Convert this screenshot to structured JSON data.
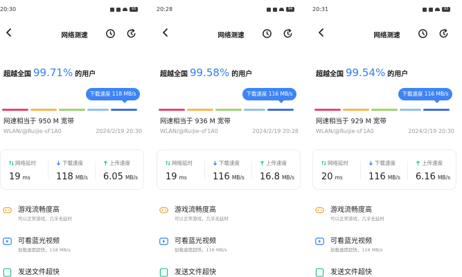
{
  "title": "网络测速",
  "headline_prefix": "超越全国",
  "headline_suffix": "的用户",
  "wifi_label": "WLAN/@Ruijie-sF1A0",
  "metric_labels": {
    "latency": "网络延时",
    "download": "下载速度",
    "upload": "上传速度"
  },
  "colors": {
    "accent": "#2f7cf6",
    "tip": "#3e84f7",
    "bar": [
      "#e9456a",
      "#f5b84c",
      "#9fd46a",
      "#8cc2f0",
      "#3b6fe0"
    ]
  },
  "features": [
    {
      "icon": "gamepad-icon",
      "title": "游戏流畅度高",
      "subtitle": "可以正常游戏，几乎无延时"
    },
    {
      "icon": "video-play-icon",
      "title": "可看蓝光视频"
    },
    {
      "icon": "file-send-icon",
      "title": "发送文件超快"
    }
  ],
  "panels": [
    {
      "status_time": "20:30",
      "battery": "93",
      "percent": "99.71%",
      "tooltip": "下载速度 118 MB/s",
      "equiv": "网速相当于 950 M 宽带",
      "date": "2024/2/19 20:30",
      "latency": "19",
      "latency_unit": "ms",
      "download": "118",
      "download_unit": "MB/s",
      "upload": "6.05",
      "upload_unit": "MB/s",
      "video_sub": "加载速度超快，118 MB/s"
    },
    {
      "status_time": "20:28",
      "battery": "94",
      "percent": "99.58%",
      "tooltip": "下载速度 116 MB/s",
      "equiv": "网速相当于 936 M 宽带",
      "date": "2024/2/19 20:28",
      "latency": "19",
      "latency_unit": "ms",
      "download": "116",
      "download_unit": "MB/s",
      "upload": "16.8",
      "upload_unit": "MB/s",
      "video_sub": "加载速度超快，116 MB/s"
    },
    {
      "status_time": "20:31",
      "battery": "93",
      "percent": "99.54%",
      "tooltip": "下载速度 116 MB/s",
      "equiv": "网速相当于 929 M 宽带",
      "date": "2024/2/19 20:30",
      "latency": "20",
      "latency_unit": "ms",
      "download": "116",
      "download_unit": "MB/s",
      "upload": "6.16",
      "upload_unit": "MB/s",
      "video_sub": "加载速度超快，116 MB/s"
    }
  ]
}
